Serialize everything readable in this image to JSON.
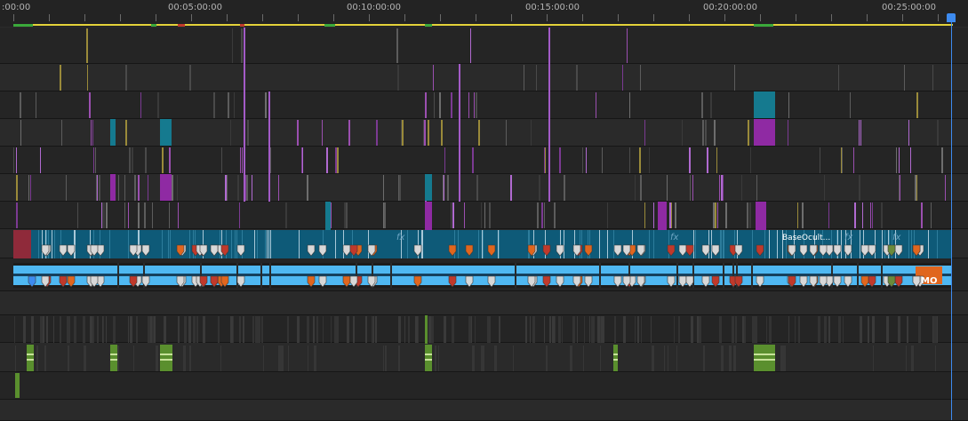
{
  "ruler": {
    "timecodes": [
      ":00:00",
      "00:05:00:00",
      "00:10:00:00",
      "00:15:00:00",
      "00:20:00:00",
      "00:25:00:00"
    ]
  },
  "timeline": {
    "clip_label": "BaseOcult...",
    "fx_symbol": "fx",
    "audio_clip_label": "MO"
  },
  "colors": {
    "work_area": "#e4d23a",
    "playhead": "#3d8bf0",
    "video_blue": "#0e5a78",
    "audio_light_blue": "#4fb8f2",
    "magenta_clip": "#8f2aa3",
    "teal_clip": "#157a8f",
    "marker_orange": "#e0661e",
    "marker_red": "#c0392b",
    "green_clip": "#5a8f2e"
  }
}
